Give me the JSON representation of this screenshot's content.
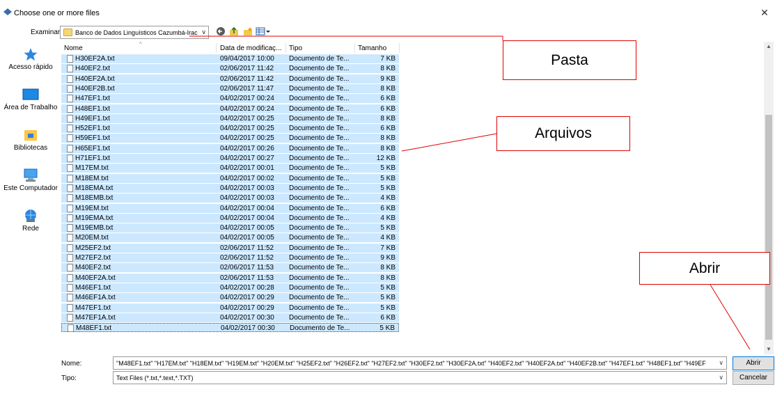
{
  "window": {
    "title": "Choose one or more files",
    "close_glyph": "✕"
  },
  "lookin": {
    "label": "Examinar:",
    "value": "Banco de Dados Linguísticos Cazumbá-Iracema",
    "icons": [
      "back-icon",
      "up-folder-icon",
      "new-folder-icon",
      "view-menu-icon"
    ]
  },
  "places": [
    {
      "label": "Acesso rápido",
      "icon": "star-icon"
    },
    {
      "label": "Área de Trabalho",
      "icon": "desktop-icon"
    },
    {
      "label": "Bibliotecas",
      "icon": "libraries-icon"
    },
    {
      "label": "Este Computador",
      "icon": "computer-icon"
    },
    {
      "label": "Rede",
      "icon": "network-icon"
    }
  ],
  "columns": {
    "name": "Nome",
    "date": "Data de modificaç...",
    "type": "Tipo",
    "size": "Tamanho"
  },
  "files": [
    {
      "name": "H30EF2A.txt",
      "date": "09/04/2017 10:00",
      "type": "Documento de Te...",
      "size": "7 KB"
    },
    {
      "name": "H40EF2.txt",
      "date": "02/06/2017 11:42",
      "type": "Documento de Te...",
      "size": "8 KB"
    },
    {
      "name": "H40EF2A.txt",
      "date": "02/06/2017 11:42",
      "type": "Documento de Te...",
      "size": "9 KB"
    },
    {
      "name": "H40EF2B.txt",
      "date": "02/06/2017 11:47",
      "type": "Documento de Te...",
      "size": "8 KB"
    },
    {
      "name": "H47EF1.txt",
      "date": "04/02/2017 00:24",
      "type": "Documento de Te...",
      "size": "6 KB"
    },
    {
      "name": "H48EF1.txt",
      "date": "04/02/2017 00:24",
      "type": "Documento de Te...",
      "size": "6 KB"
    },
    {
      "name": "H49EF1.txt",
      "date": "04/02/2017 00:25",
      "type": "Documento de Te...",
      "size": "8 KB"
    },
    {
      "name": "H52EF1.txt",
      "date": "04/02/2017 00:25",
      "type": "Documento de Te...",
      "size": "6 KB"
    },
    {
      "name": "H59EF1.txt",
      "date": "04/02/2017 00:25",
      "type": "Documento de Te...",
      "size": "8 KB"
    },
    {
      "name": "H65EF1.txt",
      "date": "04/02/2017 00:26",
      "type": "Documento de Te...",
      "size": "8 KB"
    },
    {
      "name": "H71EF1.txt",
      "date": "04/02/2017 00:27",
      "type": "Documento de Te...",
      "size": "12 KB"
    },
    {
      "name": "M17EM.txt",
      "date": "04/02/2017 00:01",
      "type": "Documento de Te...",
      "size": "5 KB"
    },
    {
      "name": "M18EM.txt",
      "date": "04/02/2017 00:02",
      "type": "Documento de Te...",
      "size": "5 KB"
    },
    {
      "name": "M18EMA.txt",
      "date": "04/02/2017 00:03",
      "type": "Documento de Te...",
      "size": "5 KB"
    },
    {
      "name": "M18EMB.txt",
      "date": "04/02/2017 00:03",
      "type": "Documento de Te...",
      "size": "4 KB"
    },
    {
      "name": "M19EM.txt",
      "date": "04/02/2017 00:04",
      "type": "Documento de Te...",
      "size": "6 KB"
    },
    {
      "name": "M19EMA.txt",
      "date": "04/02/2017 00:04",
      "type": "Documento de Te...",
      "size": "4 KB"
    },
    {
      "name": "M19EMB.txt",
      "date": "04/02/2017 00:05",
      "type": "Documento de Te...",
      "size": "5 KB"
    },
    {
      "name": "M20EM.txt",
      "date": "04/02/2017 00:05",
      "type": "Documento de Te...",
      "size": "4 KB"
    },
    {
      "name": "M25EF2.txt",
      "date": "02/06/2017 11:52",
      "type": "Documento de Te...",
      "size": "7 KB"
    },
    {
      "name": "M27EF2.txt",
      "date": "02/06/2017 11:52",
      "type": "Documento de Te...",
      "size": "9 KB"
    },
    {
      "name": "M40EF2.txt",
      "date": "02/06/2017 11:53",
      "type": "Documento de Te...",
      "size": "8 KB"
    },
    {
      "name": "M40EF2A.txt",
      "date": "02/06/2017 11:53",
      "type": "Documento de Te...",
      "size": "8 KB"
    },
    {
      "name": "M46EF1.txt",
      "date": "04/02/2017 00:28",
      "type": "Documento de Te...",
      "size": "5 KB"
    },
    {
      "name": "M46EF1A.txt",
      "date": "04/02/2017 00:29",
      "type": "Documento de Te...",
      "size": "5 KB"
    },
    {
      "name": "M47EF1.txt",
      "date": "04/02/2017 00:29",
      "type": "Documento de Te...",
      "size": "5 KB"
    },
    {
      "name": "M47EF1A.txt",
      "date": "04/02/2017 00:30",
      "type": "Documento de Te...",
      "size": "6 KB"
    },
    {
      "name": "M48EF1.txt",
      "date": "04/02/2017 00:30",
      "type": "Documento de Te...",
      "size": "5 KB"
    }
  ],
  "annotations": {
    "pasta": "Pasta",
    "arquivos": "Arquivos",
    "abrir": "Abrir"
  },
  "filename": {
    "label": "Nome:",
    "value": "\"M48EF1.txt\" \"H17EM.txt\" \"H18EM.txt\" \"H19EM.txt\" \"H20EM.txt\" \"H25EF2.txt\" \"H26EF2.txt\" \"H27EF2.txt\" \"H30EF2.txt\" \"H30EF2A.txt\" \"H40EF2.txt\" \"H40EF2A.txt\" \"H40EF2B.txt\" \"H47EF1.txt\" \"H48EF1.txt\" \"H49EF"
  },
  "filetype": {
    "label": "Tipo:",
    "value": "Text Files (*.txt,*.text,*.TXT)"
  },
  "buttons": {
    "open": "Abrir",
    "cancel": "Cancelar"
  },
  "colors": {
    "selection": "#cce8ff",
    "annotation": "#e00000",
    "default_button_border": "#0078d7"
  }
}
